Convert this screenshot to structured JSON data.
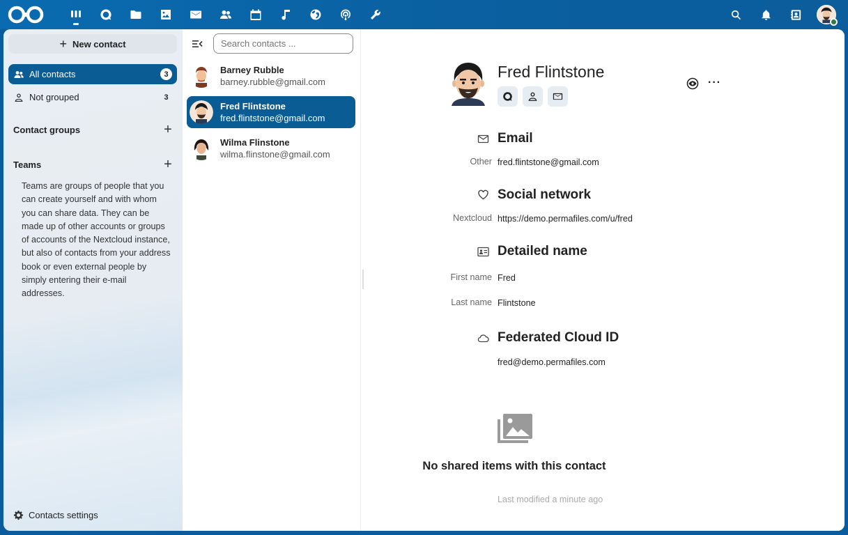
{
  "header": {
    "apps": [
      {
        "name": "dashboard",
        "icon": "dashboard-icon",
        "active": true
      },
      {
        "name": "talk",
        "icon": "talk-icon"
      },
      {
        "name": "files",
        "icon": "folder-icon"
      },
      {
        "name": "photos",
        "icon": "image-icon"
      },
      {
        "name": "mail",
        "icon": "mail-icon"
      },
      {
        "name": "contacts",
        "icon": "contacts-icon"
      },
      {
        "name": "calendar",
        "icon": "calendar-icon"
      },
      {
        "name": "music",
        "icon": "music-icon"
      },
      {
        "name": "world",
        "icon": "globe-icon"
      },
      {
        "name": "podcast",
        "icon": "podcast-icon"
      },
      {
        "name": "tools",
        "icon": "wrench-icon"
      }
    ],
    "right_icons": [
      "search-icon",
      "bell-icon",
      "contacts-menu-icon"
    ]
  },
  "nav": {
    "new_contact": "New contact",
    "all_contacts": "All contacts",
    "all_count": "3",
    "not_grouped": "Not grouped",
    "not_grouped_count": "3",
    "contact_groups": "Contact groups",
    "teams": "Teams",
    "teams_description": "Teams are groups of people that you can create yourself and with whom you can share data. They can be made up of other accounts or groups of accounts of the Nextcloud instance, but also of contacts from your address book or even external people by simply entering their e-mail addresses.",
    "settings": "Contacts settings"
  },
  "list": {
    "search_placeholder": "Search contacts ...",
    "contacts": [
      {
        "name": "Barney Rubble",
        "email": "barney.rubble@gmail.com"
      },
      {
        "name": "Fred Flintstone",
        "email": "fred.flintstone@gmail.com"
      },
      {
        "name": "Wilma Flinstone",
        "email": "wilma.flinstone@gmail.com"
      }
    ]
  },
  "detail": {
    "full_name": "Fred Flintstone",
    "email_title": "Email",
    "email_label": "Other",
    "email_value": "fred.flintstone@gmail.com",
    "social_title": "Social network",
    "social_label": "Nextcloud",
    "social_value": "https://demo.permafiles.com/u/fred",
    "detailed_title": "Detailed name",
    "first_label": "First name",
    "first_value": "Fred",
    "last_label": "Last name",
    "last_value": "Flintstone",
    "cloud_title": "Federated Cloud ID",
    "cloud_value": "fred@demo.permafiles.com",
    "shared_empty": "No shared items with this contact",
    "modified": "Last modified a minute ago"
  },
  "colors": {
    "accent": "#0a5c94",
    "header": "#0a6bb0"
  }
}
